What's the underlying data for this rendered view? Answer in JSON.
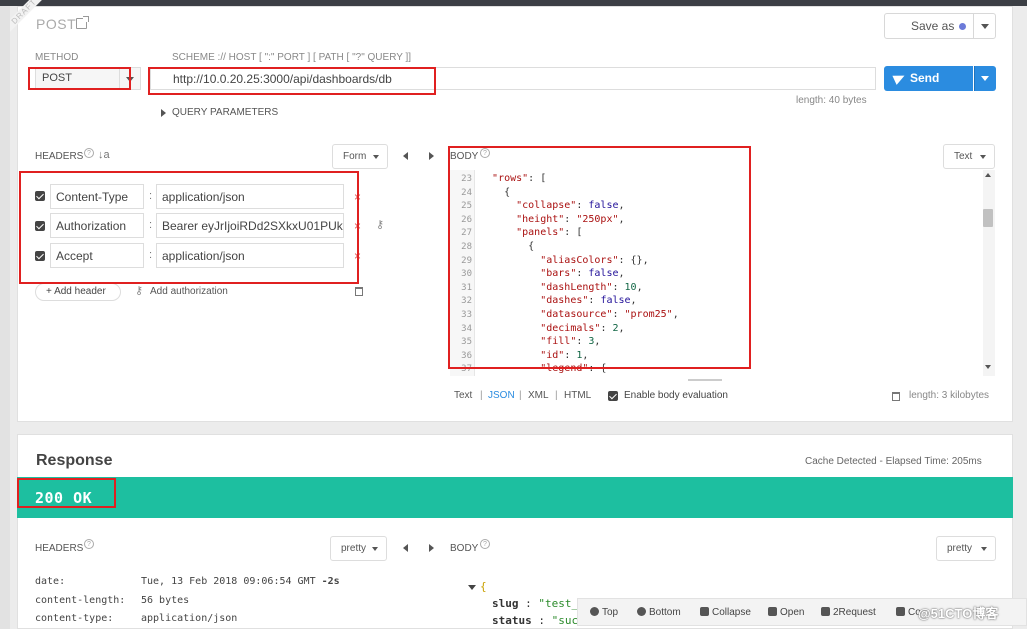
{
  "request": {
    "draft_ribbon": "DRAFT",
    "title": "POST",
    "save_as": "Save as",
    "method_label": "METHOD",
    "method_value": "POST",
    "scheme_label": "SCHEME :// HOST [ \":\" PORT ] [ PATH [ \"?\" QUERY ]]",
    "url": "http://10.0.20.25:3000/api/dashboards/db",
    "send": "Send",
    "url_length": "length: 40 bytes",
    "query_params": "QUERY PARAMETERS",
    "headers_label": "HEADERS",
    "headers_mode": "Form",
    "headers": [
      {
        "name": "Content-Type",
        "value": "application/json"
      },
      {
        "name": "Authorization",
        "value": "Bearer eyJrIjoiRDd2SXkxU01PUkl"
      },
      {
        "name": "Accept",
        "value": "application/json"
      }
    ],
    "add_header": "+ Add header",
    "add_authorization": "Add authorization",
    "body_label": "BODY",
    "body_mode": "Text",
    "body_lines": [
      {
        "n": "23",
        "html": "  <span class='k'>\"rows\"</span>: ["
      },
      {
        "n": "24",
        "html": "    {"
      },
      {
        "n": "25",
        "html": "      <span class='k'>\"collapse\"</span>: <span class='b'>false</span>,"
      },
      {
        "n": "26",
        "html": "      <span class='k'>\"height\"</span>: <span class='s'>\"250px\"</span>,"
      },
      {
        "n": "27",
        "html": "      <span class='k'>\"panels\"</span>: ["
      },
      {
        "n": "28",
        "html": "        {"
      },
      {
        "n": "29",
        "html": "          <span class='k'>\"aliasColors\"</span>: {},"
      },
      {
        "n": "30",
        "html": "          <span class='k'>\"bars\"</span>: <span class='b'>false</span>,"
      },
      {
        "n": "31",
        "html": "          <span class='k'>\"dashLength\"</span>: <span class='n'>10</span>,"
      },
      {
        "n": "32",
        "html": "          <span class='k'>\"dashes\"</span>: <span class='b'>false</span>,"
      },
      {
        "n": "33",
        "html": "          <span class='k'>\"datasource\"</span>: <span class='s'>\"prom25\"</span>,"
      },
      {
        "n": "34",
        "html": "          <span class='k'>\"decimals\"</span>: <span class='n'>2</span>,"
      },
      {
        "n": "35",
        "html": "          <span class='k'>\"fill\"</span>: <span class='n'>3</span>,"
      },
      {
        "n": "36",
        "html": "          <span class='k'>\"id\"</span>: <span class='n'>1</span>,"
      },
      {
        "n": "37",
        "html": "          <span class='k'>\"legend\"</span>: {"
      }
    ],
    "body_formats": [
      "Text",
      "JSON",
      "XML",
      "HTML"
    ],
    "body_format_active": "JSON",
    "enable_eval": "Enable body evaluation",
    "body_length": "length: 3 kilobytes"
  },
  "response": {
    "title": "Response",
    "elapsed": "Cache Detected - Elapsed Time: 205ms",
    "status": "200 OK",
    "headers_label": "HEADERS",
    "headers_mode": "pretty",
    "headers": [
      {
        "name": "date:",
        "value": "Tue, 13 Feb 2018 09:06:54 GMT ",
        "extra": "-2s"
      },
      {
        "name": "content-length:",
        "value": "56 bytes",
        "extra": ""
      },
      {
        "name": "content-type:",
        "value": "application/json",
        "extra": ""
      }
    ],
    "body_label": "BODY",
    "body_mode": "pretty",
    "body_brace": "{",
    "body_fields": [
      {
        "key": "slug",
        "value": "\"test_"
      },
      {
        "key": "status",
        "value": "\"suc"
      }
    ]
  },
  "floatbar": {
    "top": "Top",
    "bottom": "Bottom",
    "collapse": "Collapse",
    "open": "Open",
    "to_request": "2Request",
    "copy": "Co"
  },
  "watermark": "@51CTO博客",
  "colors": {
    "accent": "#2b8ce0",
    "status_ok": "#1dbfa0",
    "annotation": "#e02020"
  }
}
